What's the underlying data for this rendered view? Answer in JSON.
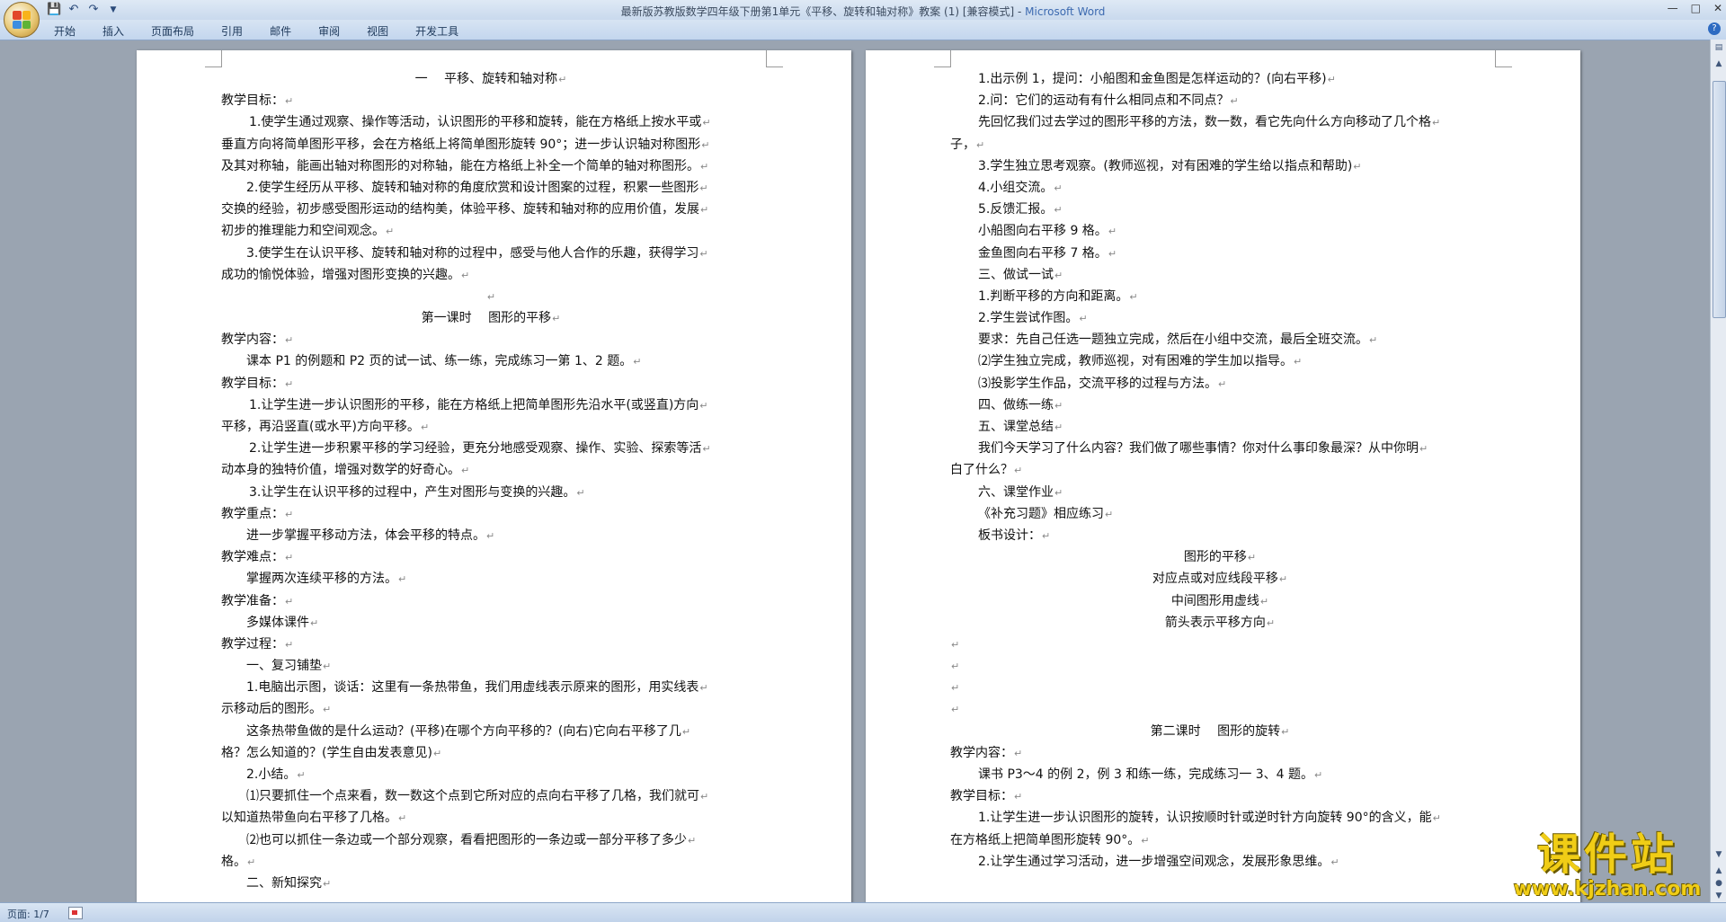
{
  "window": {
    "title": "最新版苏教版数学四年级下册第1单元《平移、旋转和轴对称》教案 (1) [兼容模式] - ",
    "app_name": "Microsoft Word"
  },
  "ribbon_tabs": [
    "开始",
    "插入",
    "页面布局",
    "引用",
    "邮件",
    "审阅",
    "视图",
    "开发工具"
  ],
  "pages": {
    "left": [
      {
        "t": "一　 平移、旋转和轴对称",
        "a": "c"
      },
      {
        "t": "教学目标：",
        "a": "l"
      },
      {
        "t": "1.使学生通过观察、操作等活动，认识图形的平移和旋转，能在方格纸上按水平或",
        "a": "i1"
      },
      {
        "t": "垂直方向将简单图形平移，会在方格纸上将简单图形旋转 90°；进一步认识轴对称图形",
        "a": "l"
      },
      {
        "t": "及其对称轴，能画出轴对称图形的对称轴，能在方格纸上补全一个简单的轴对称图形。",
        "a": "l"
      },
      {
        "t": "2.使学生经历从平移、旋转和轴对称的角度欣赏和设计图案的过程，积累一些图形",
        "a": "i2"
      },
      {
        "t": "交换的经验，初步感受图形运动的结构美，体验平移、旋转和轴对称的应用价值，发展",
        "a": "l"
      },
      {
        "t": "初步的推理能力和空间观念。",
        "a": "l"
      },
      {
        "t": "3.使学生在认识平移、旋转和轴对称的过程中，感受与他人合作的乐趣，获得学习",
        "a": "i2"
      },
      {
        "t": "成功的愉悦体验，增强对图形变换的兴趣。",
        "a": "l"
      },
      {
        "t": "",
        "a": "c"
      },
      {
        "t": "第一课时　 图形的平移",
        "a": "c"
      },
      {
        "t": "教学内容：",
        "a": "l"
      },
      {
        "t": "课本 P1 的例题和 P2 页的试一试、练一练，完成练习一第 1、2 题。",
        "a": "i2"
      },
      {
        "t": "教学目标：",
        "a": "l"
      },
      {
        "t": "1.让学生进一步认识图形的平移，能在方格纸上把简单图形先沿水平(或竖直)方向",
        "a": "i1"
      },
      {
        "t": "平移，再沿竖直(或水平)方向平移。",
        "a": "l"
      },
      {
        "t": "2.让学生进一步积累平移的学习经验，更充分地感受观察、操作、实验、探索等活",
        "a": "i1"
      },
      {
        "t": "动本身的独特价值，增强对数学的好奇心。",
        "a": "l"
      },
      {
        "t": "3.让学生在认识平移的过程中，产生对图形与变换的兴趣。",
        "a": "i1"
      },
      {
        "t": "教学重点：",
        "a": "l"
      },
      {
        "t": "进一步掌握平移动方法，体会平移的特点。",
        "a": "i2"
      },
      {
        "t": "教学难点：",
        "a": "l"
      },
      {
        "t": "掌握两次连续平移的方法。",
        "a": "i2"
      },
      {
        "t": "教学准备：",
        "a": "l"
      },
      {
        "t": "多媒体课件",
        "a": "i2"
      },
      {
        "t": "教学过程：",
        "a": "l"
      },
      {
        "t": "一、复习铺垫",
        "a": "i2"
      },
      {
        "t": "1.电脑出示图，谈话：这里有一条热带鱼，我们用虚线表示原来的图形，用实线表",
        "a": "i2"
      },
      {
        "t": "示移动后的图形。",
        "a": "l"
      },
      {
        "t": "这条热带鱼做的是什么运动？(平移)在哪个方向平移的？(向右)它向右平移了几",
        "a": "i2"
      },
      {
        "t": "格？怎么知道的？(学生自由发表意见)",
        "a": "l"
      },
      {
        "t": "2.小结。",
        "a": "i2"
      },
      {
        "t": "⑴只要抓住一个点来看，数一数这个点到它所对应的点向右平移了几格，我们就可",
        "a": "i2"
      },
      {
        "t": "以知道热带鱼向右平移了几格。",
        "a": "l"
      },
      {
        "t": "⑵也可以抓住一条边或一个部分观察，看看把图形的一条边或一部分平移了多少",
        "a": "i2"
      },
      {
        "t": "格。",
        "a": "l"
      },
      {
        "t": "二、新知探究",
        "a": "i2"
      }
    ],
    "right": [
      {
        "t": "1.出示例 1，提问：小船图和金鱼图是怎样运动的？(向右平移)",
        "a": "i1"
      },
      {
        "t": "2.问：它们的运动有有什么相同点和不同点？",
        "a": "i1"
      },
      {
        "t": "先回忆我们过去学过的图形平移的方法，数一数，看它先向什么方向移动了几个格",
        "a": "i1"
      },
      {
        "t": "子，",
        "a": "l"
      },
      {
        "t": "3.学生独立思考观察。(教师巡视，对有困难的学生给以指点和帮助)",
        "a": "i1"
      },
      {
        "t": "4.小组交流。",
        "a": "i1"
      },
      {
        "t": "5.反馈汇报。",
        "a": "i1"
      },
      {
        "t": "小船图向右平移 9 格。",
        "a": "i1"
      },
      {
        "t": "金鱼图向右平移 7 格。",
        "a": "i1"
      },
      {
        "t": "三、做试一试",
        "a": "i1"
      },
      {
        "t": "1.判断平移的方向和距离。",
        "a": "i1"
      },
      {
        "t": "2.学生尝试作图。",
        "a": "i1"
      },
      {
        "t": "要求：先自己任选一题独立完成，然后在小组中交流，最后全班交流。",
        "a": "i1"
      },
      {
        "t": "⑵学生独立完成，教师巡视，对有困难的学生加以指导。",
        "a": "i1"
      },
      {
        "t": "⑶投影学生作品，交流平移的过程与方法。",
        "a": "i1"
      },
      {
        "t": "四、做练一练",
        "a": "i1"
      },
      {
        "t": "五、课堂总结",
        "a": "i1"
      },
      {
        "t": "我们今天学习了什么内容？我们做了哪些事情？你对什么事印象最深？从中你明",
        "a": "i1"
      },
      {
        "t": "白了什么？",
        "a": "l"
      },
      {
        "t": "六、课堂作业",
        "a": "i1"
      },
      {
        "t": "《补充习题》相应练习",
        "a": "i1"
      },
      {
        "t": "板书设计：",
        "a": "i1"
      },
      {
        "t": "图形的平移",
        "a": "c"
      },
      {
        "t": "对应点或对应线段平移",
        "a": "c"
      },
      {
        "t": "中间图形用虚线",
        "a": "c"
      },
      {
        "t": "箭头表示平移方向",
        "a": "c"
      },
      {
        "t": "",
        "a": "l"
      },
      {
        "t": "",
        "a": "l"
      },
      {
        "t": "",
        "a": "l"
      },
      {
        "t": "",
        "a": "l"
      },
      {
        "t": "第二课时　 图形的旋转",
        "a": "c"
      },
      {
        "t": "教学内容：",
        "a": "l"
      },
      {
        "t": "课书 P3～4 的例 2，例 3 和练一练，完成练习一 3、4 题。",
        "a": "i1"
      },
      {
        "t": "教学目标：",
        "a": "l"
      },
      {
        "t": "1.让学生进一步认识图形的旋转，认识按顺时针或逆时针方向旋转 90°的含义，能",
        "a": "i1"
      },
      {
        "t": "在方格纸上把简单图形旋转 90°。",
        "a": "l"
      },
      {
        "t": "2.让学生通过学习活动，进一步增强空间观念，发展形象思维。",
        "a": "i1"
      }
    ]
  },
  "status": {
    "page_label": "页面: 1/7"
  },
  "watermark": {
    "title": "课件站",
    "url": "www.kjzhan.com"
  },
  "colors": {
    "ribbon": "#c9d9ed",
    "workspace": "#9aa4b1",
    "watermark": "#f0cd16"
  }
}
